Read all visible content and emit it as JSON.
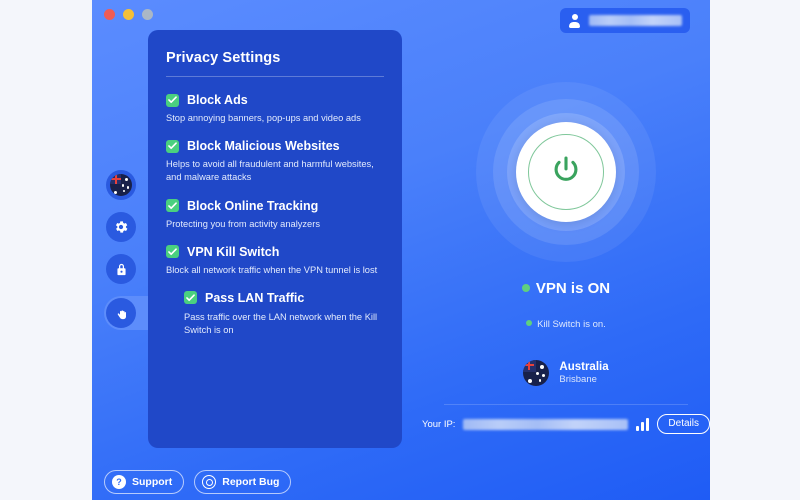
{
  "window": {
    "traffic_lights": [
      "close",
      "minimize",
      "zoom"
    ]
  },
  "account": {
    "icon": "person-icon",
    "username_redacted": true
  },
  "rail": {
    "items": [
      {
        "icon": "australia-flag-icon",
        "name": "location",
        "active": false
      },
      {
        "icon": "gear-icon",
        "name": "settings",
        "active": false
      },
      {
        "icon": "lock-icon",
        "name": "security",
        "active": false
      },
      {
        "icon": "hand-icon",
        "name": "privacy",
        "active": true
      }
    ]
  },
  "privacy_panel": {
    "title": "Privacy Settings",
    "settings": [
      {
        "label": "Block Ads",
        "description": "Stop annoying banners, pop-ups and video ads",
        "checked": true,
        "nested": false
      },
      {
        "label": "Block Malicious Websites",
        "description": "Helps to avoid all fraudulent and harmful websites, and malware attacks",
        "checked": true,
        "nested": false
      },
      {
        "label": "Block Online Tracking",
        "description": "Protecting you from activity analyzers",
        "checked": true,
        "nested": false
      },
      {
        "label": "VPN Kill Switch",
        "description": "Block all network traffic when the VPN tunnel is lost",
        "checked": true,
        "nested": false
      },
      {
        "label": "Pass LAN Traffic",
        "description": "Pass traffic over the LAN network when the Kill Switch is on",
        "checked": true,
        "nested": true
      }
    ]
  },
  "status": {
    "power_state": "on",
    "vpn_status": "VPN is ON",
    "kill_switch_status": "Kill Switch is on.",
    "location": {
      "country": "Australia",
      "city": "Brisbane",
      "flag": "australia-flag-icon"
    },
    "ip_label": "Your IP:",
    "ip_redacted": true,
    "signal_bars": 3,
    "details_label": "Details"
  },
  "bottom_bar": {
    "support_label": "Support",
    "support_icon": "question-circle-icon",
    "report_bug_label": "Report Bug",
    "report_bug_icon": "bug-circle-icon"
  },
  "colors": {
    "app_background": "#4a80fa",
    "panel_background": "#2048c8",
    "checkbox_green": "#4ad07f",
    "status_green": "#5fd07f",
    "power_glyph_green": "#3aa35e",
    "page_background": "#f4f6fb"
  }
}
